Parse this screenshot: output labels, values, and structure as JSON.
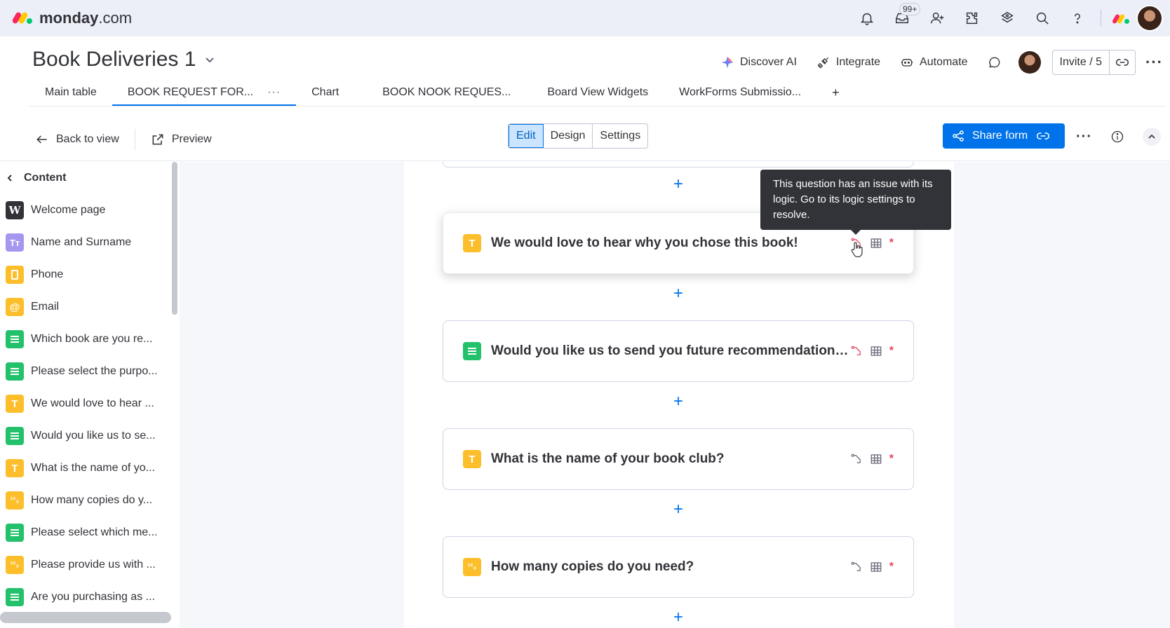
{
  "app": {
    "brand": "monday",
    "brand_suffix": ".com",
    "notifications_badge": "99+"
  },
  "board": {
    "title": "Book Deliveries 1",
    "actions": {
      "discover_ai": "Discover AI",
      "integrate": "Integrate",
      "automate": "Automate",
      "invite": "Invite / 5"
    },
    "tabs": [
      {
        "label": "Main table"
      },
      {
        "label": "BOOK REQUEST FOR..."
      },
      {
        "label": "Chart"
      },
      {
        "label": "BOOK NOOK REQUES..."
      },
      {
        "label": "Board View Widgets"
      },
      {
        "label": "WorkForms Submissio..."
      },
      {
        "label": "+"
      }
    ],
    "tab_more": "···"
  },
  "toolbar": {
    "back": "Back to view",
    "preview": "Preview",
    "modes": [
      "Edit",
      "Design",
      "Settings"
    ],
    "active_mode": "Edit",
    "share": "Share form",
    "more": "···"
  },
  "sidebar": {
    "heading": "Content",
    "items": [
      {
        "label": "Welcome page",
        "icon": "W"
      },
      {
        "label": "Name and Surname",
        "icon": "Tт"
      },
      {
        "label": "Phone",
        "icon": "phone-icon"
      },
      {
        "label": "Email",
        "icon": "@"
      },
      {
        "label": "Which book are you re...",
        "icon": "list-icon"
      },
      {
        "label": "Please select the purpo...",
        "icon": "list-icon"
      },
      {
        "label": "We would love to hear ...",
        "icon": "T"
      },
      {
        "label": "Would you like us to se...",
        "icon": "list-icon"
      },
      {
        "label": "What is the name of yo...",
        "icon": "T"
      },
      {
        "label": "How many copies do y...",
        "icon": "¹²₃"
      },
      {
        "label": "Please select which me...",
        "icon": "list-icon"
      },
      {
        "label": "Please provide us with ...",
        "icon": "¹²₃"
      },
      {
        "label": "Are you purchasing as ...",
        "icon": "list-icon"
      }
    ]
  },
  "form": {
    "questions": [
      {
        "title": "We would love to hear why you chose this book!",
        "icon": "T",
        "required": "*"
      },
      {
        "title": "Would you like us to send you future recommendations ba...",
        "icon": "list-icon",
        "required": "*"
      },
      {
        "title": "What is the name of your book club?",
        "icon": "T",
        "required": "*"
      },
      {
        "title": "How many copies do you need?",
        "icon": "¹²₃",
        "required": "*"
      }
    ],
    "add": "+"
  },
  "tooltip": {
    "text": "This question has an issue with its logic. Go to its logic settings to resolve."
  },
  "colors": {
    "primary": "#0073ea",
    "error": "#e2445c",
    "text_icon_yellow": "#fdbe2b",
    "list_icon_green": "#23c16b",
    "name_icon_purple": "#a497f0"
  }
}
